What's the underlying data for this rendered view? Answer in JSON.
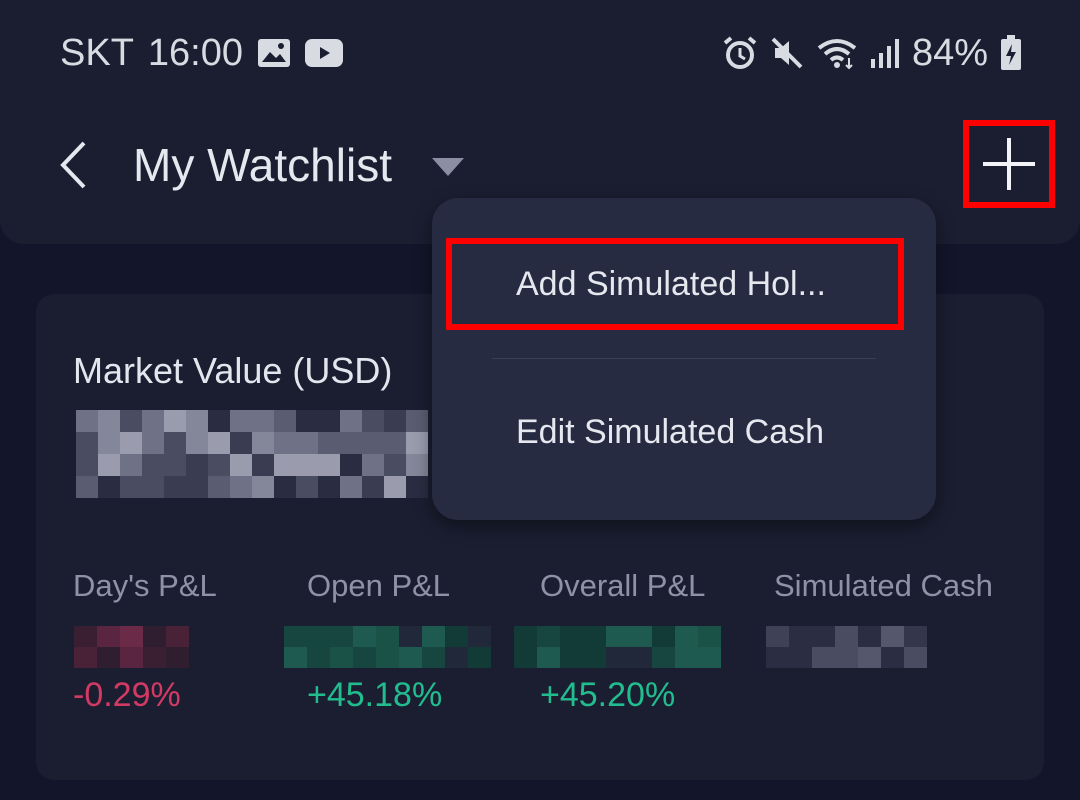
{
  "status_bar": {
    "carrier": "SKT",
    "time": "16:00",
    "battery": "84%",
    "left_icons": [
      "image-icon",
      "video-icon"
    ],
    "right_icons": [
      "alarm-icon",
      "mute-icon",
      "wifi-icon",
      "signal-icon",
      "battery-icon"
    ]
  },
  "header": {
    "title": "My Watchlist",
    "back_icon": "chevron-left-icon",
    "dropdown_icon": "caret-down-icon",
    "add_icon": "plus-icon"
  },
  "menu": {
    "items": [
      {
        "label": "Add Simulated Hol..."
      },
      {
        "label": "Edit Simulated Cash"
      }
    ]
  },
  "summary": {
    "market_value_label": "Market Value  (USD)",
    "metrics": [
      {
        "label": "Day's P&L",
        "pct": "-0.29%"
      },
      {
        "label": "Open P&L",
        "pct": "+45.18%"
      },
      {
        "label": "Overall P&L",
        "pct": "+45.20%"
      },
      {
        "label": "Simulated Cash",
        "pct": ""
      }
    ]
  },
  "colors": {
    "negative": "#d33a63",
    "positive": "#21bd8f",
    "highlight": "#ff0000",
    "background": "#13162a",
    "surface": "#1b1e31",
    "popup": "#272b41"
  }
}
